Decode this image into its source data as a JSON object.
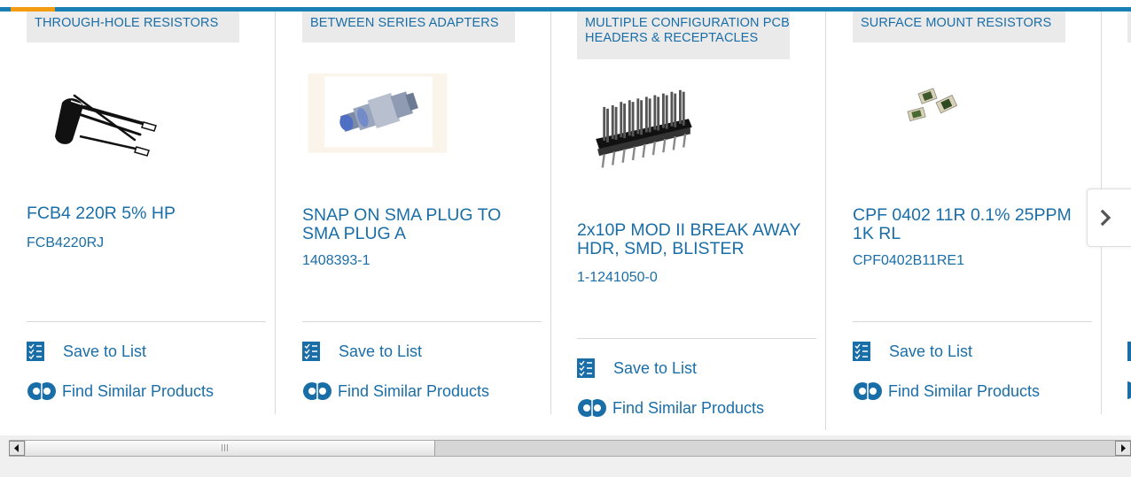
{
  "cards": [
    {
      "category": "THROUGH-HOLE RESISTORS",
      "title": "FCB4 220R 5% HP",
      "part_number": "FCB4220RJ",
      "save_label": "Save to List",
      "similar_label": "Find Similar Products",
      "image_icon": "through-hole-resistor-image"
    },
    {
      "category": "BETWEEN SERIES ADAPTERS",
      "title": "SNAP ON SMA PLUG TO SMA PLUG A",
      "part_number": "1408393-1",
      "save_label": "Save to List",
      "similar_label": "Find Similar Products",
      "image_icon": "sma-adapter-image"
    },
    {
      "category": "MULTIPLE CONFIGURATION PCB HEADERS & RECEPTACLES",
      "title": "2x10P MOD II BREAK AWAY HDR, SMD, BLISTER",
      "part_number": "1-1241050-0",
      "save_label": "Save to List",
      "similar_label": "Find Similar Products",
      "image_icon": "pcb-header-image"
    },
    {
      "category": "SURFACE MOUNT RESISTORS",
      "title": "CPF 0402 11R 0.1% 25PPM 1K RL",
      "part_number": "CPF0402B11RE1",
      "save_label": "Save to List",
      "similar_label": "Find Similar Products",
      "image_icon": "smd-resistor-image"
    }
  ],
  "carousel": {
    "next_icon": "chevron-right-icon"
  },
  "colors": {
    "link": "#1a6ea8",
    "accent_bar": "#1a7fb5",
    "accent_highlight": "#f39c12",
    "tag_bg": "#eaeaea"
  }
}
